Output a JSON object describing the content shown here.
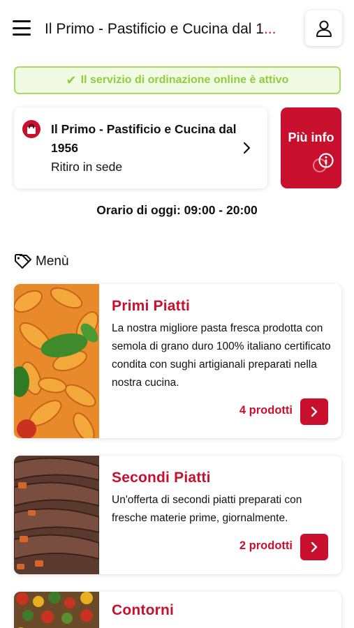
{
  "header": {
    "title": "Il Primo - Pastificio e Cucina dal 1",
    "title_ellipsis": "...",
    "menu_icon": "hamburger-icon",
    "user_icon": "user-icon"
  },
  "status_banner": {
    "text": "Il servizio di ordinazione online è attivo",
    "icon": "check-icon",
    "color": "#8fcc3e"
  },
  "store": {
    "name": "Il Primo - Pastificio e Cucina dal 1956",
    "mode": "Ritiro in sede",
    "icon": "shopping-bag-icon"
  },
  "info_button": {
    "label": "Più info",
    "icon": "info-icon"
  },
  "hours": "Orario di oggi: 09:00 - 20:00",
  "menu": {
    "heading": "Menù",
    "icon": "tag-icon",
    "categories": [
      {
        "title": "Primi Piatti",
        "description": "La nostra migliore pasta fresca prodotta con semola di grano duro 100% italiano certificato condita con sughi artigianali preparati nella nostra cucina.",
        "count": "4 prodotti"
      },
      {
        "title": "Secondi Piatti",
        "description": "Un'offerta di secondi piatti preparati con fresche materie prime, giornalmente.",
        "count": "2 prodotti"
      },
      {
        "title": "Contorni",
        "description": "",
        "count": ""
      }
    ]
  },
  "colors": {
    "accent": "#c8102e",
    "success": "#8fcc3e"
  }
}
